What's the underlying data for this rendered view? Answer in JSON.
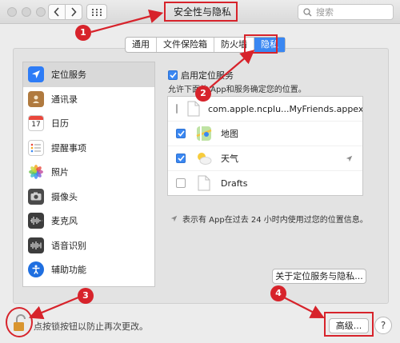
{
  "window": {
    "title": "安全性与隐私"
  },
  "search": {
    "placeholder": "搜索"
  },
  "tabs": [
    {
      "label": "通用",
      "active": false
    },
    {
      "label": "文件保险箱",
      "active": false
    },
    {
      "label": "防火墙",
      "active": false
    },
    {
      "label": "隐私",
      "active": true
    }
  ],
  "sidebar": {
    "items": [
      {
        "label": "定位服务",
        "icon": "location-arrow-icon",
        "selected": true
      },
      {
        "label": "通讯录",
        "icon": "contacts-icon",
        "selected": false
      },
      {
        "label": "日历",
        "icon": "calendar-icon",
        "calendar_day": "17",
        "selected": false
      },
      {
        "label": "提醒事项",
        "icon": "reminders-icon",
        "selected": false
      },
      {
        "label": "照片",
        "icon": "photos-icon",
        "selected": false
      },
      {
        "label": "摄像头",
        "icon": "camera-icon",
        "selected": false
      },
      {
        "label": "麦克风",
        "icon": "microphone-icon",
        "selected": false
      },
      {
        "label": "语音识别",
        "icon": "speech-recognition-icon",
        "selected": false
      },
      {
        "label": "辅助功能",
        "icon": "accessibility-icon",
        "selected": false
      }
    ]
  },
  "location": {
    "enable_label": "启用定位服务",
    "enabled": true,
    "description": "允许下面的 App和服务确定您的位置。",
    "apps": [
      {
        "name": "com.apple.ncplu...MyFriends.appex",
        "checked": false,
        "icon": "document-icon",
        "recent": false
      },
      {
        "name": "地图",
        "checked": true,
        "icon": "maps-icon",
        "recent": false
      },
      {
        "name": "天气",
        "checked": true,
        "icon": "weather-icon",
        "recent": true
      },
      {
        "name": "Drafts",
        "checked": false,
        "icon": "document-icon",
        "recent": false
      }
    ],
    "note": "表示有 App在过去 24 小时内使用过您的位置信息。",
    "about_button": "关于定位服务与隐私..."
  },
  "footer": {
    "lock_text": "点按锁按钮以防止再次更改。",
    "advanced_button": "高级...",
    "help_label": "?"
  },
  "annotations": [
    "1",
    "2",
    "3",
    "4"
  ],
  "colors": {
    "accent": "#3a87f2",
    "annotation": "#d7232b"
  }
}
